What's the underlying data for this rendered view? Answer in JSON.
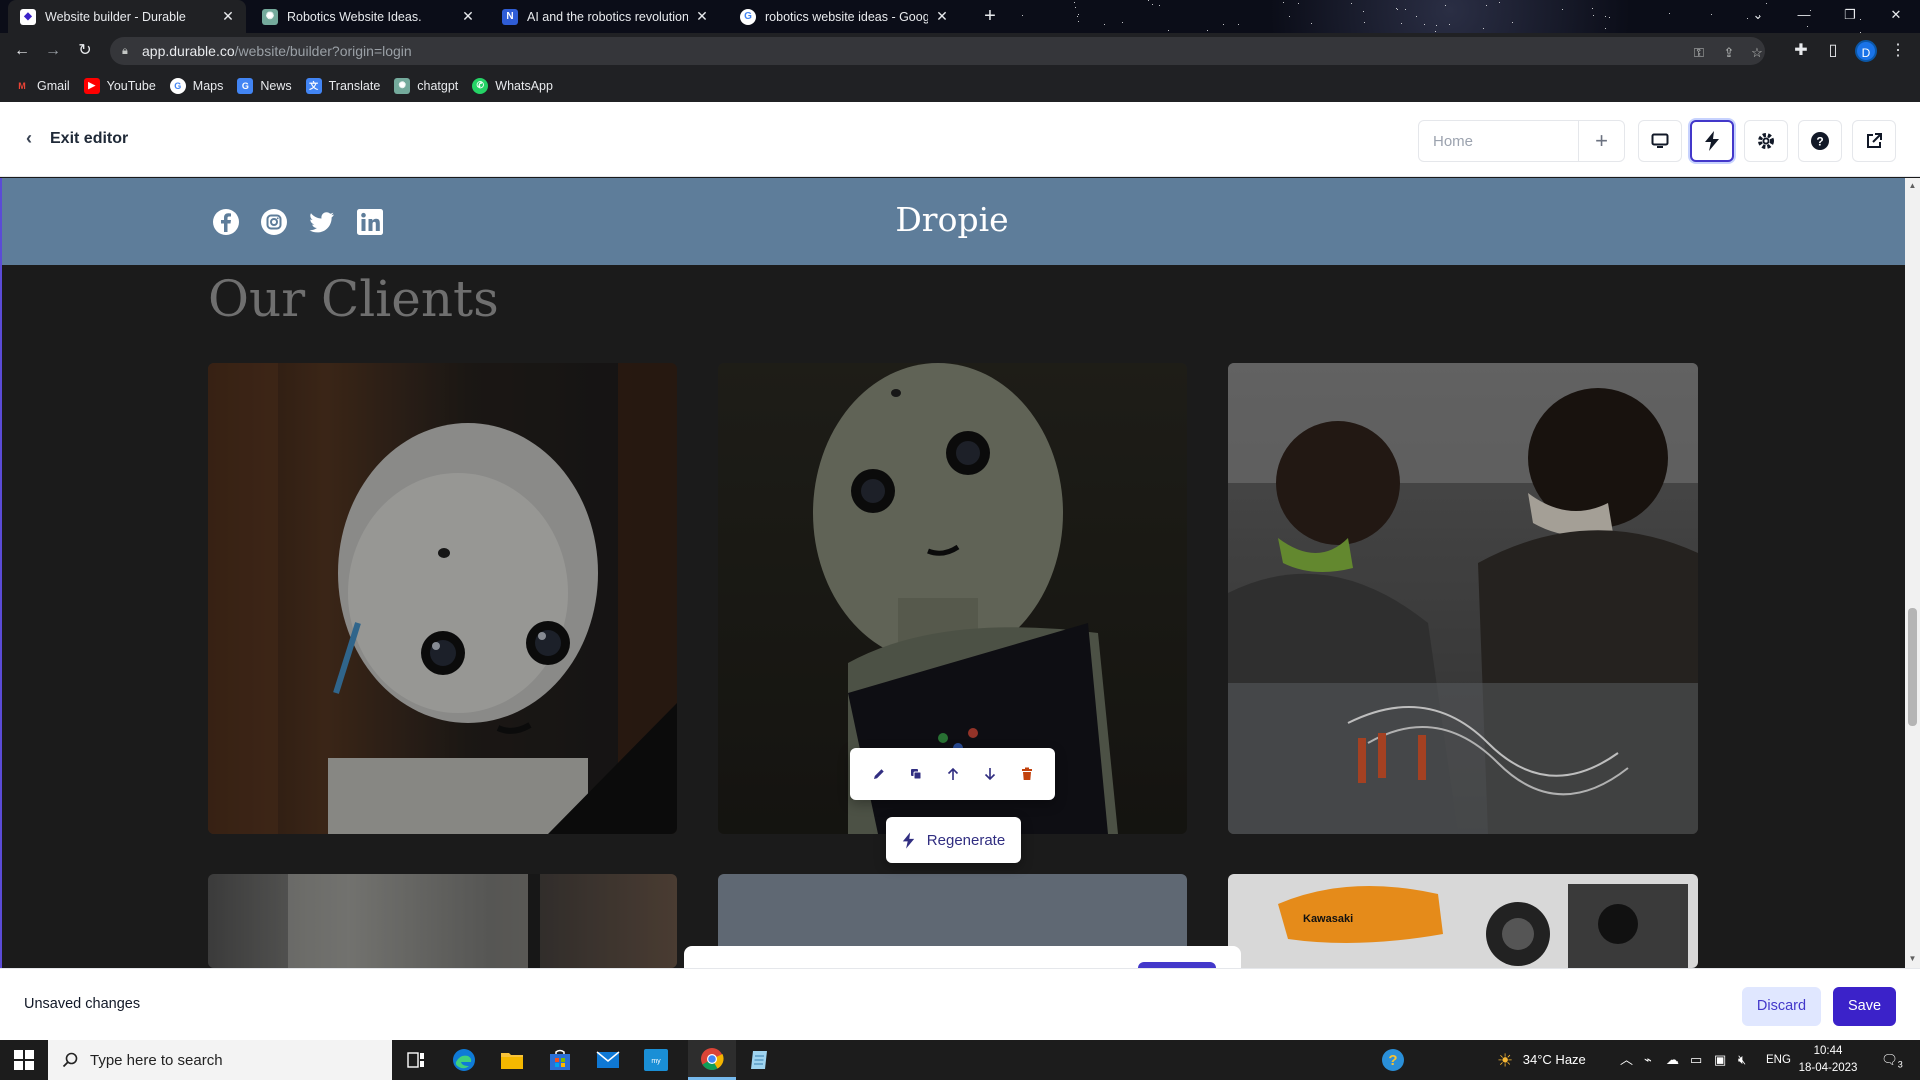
{
  "browser": {
    "tabs": [
      {
        "title": "Website builder - Durable",
        "favicon": "durable-icon",
        "active": true
      },
      {
        "title": "Robotics Website Ideas.",
        "favicon": "chatgpt-icon",
        "active": false
      },
      {
        "title": "AI and the robotics revolution W",
        "favicon": "notion-icon",
        "active": false
      },
      {
        "title": "robotics website ideas - Google",
        "favicon": "google-icon",
        "active": false
      }
    ],
    "url_host": "app.durable.co",
    "url_path": "/website/builder?origin=login",
    "profile_initial": "D",
    "bookmarks": [
      "Gmail",
      "YouTube",
      "Maps",
      "News",
      "Translate",
      "chatgpt",
      "WhatsApp"
    ]
  },
  "editor": {
    "exit_label": "Exit editor",
    "page_select": "Home",
    "header_buttons": [
      "desktop-preview-icon",
      "lightning-icon",
      "gear-icon",
      "help-icon",
      "external-link-icon"
    ]
  },
  "site": {
    "brand": "Dropie",
    "social": [
      "facebook-icon",
      "instagram-icon",
      "twitter-icon",
      "linkedin-icon"
    ],
    "section_heading": "Our Clients",
    "cards": [
      "robot-photo-1",
      "robot-photo-2",
      "engineers-photo",
      "window-photo",
      "sky-photo",
      "kawasaki-robot-photo"
    ],
    "kawasaki_label": "Kawasaki"
  },
  "floating_toolbar": [
    "edit-icon",
    "duplicate-icon",
    "move-up-icon",
    "move-down-icon",
    "delete-icon"
  ],
  "regenerate_label": "Regenerate",
  "action_bar": {
    "status": "Unsaved changes",
    "discard_label": "Discard",
    "save_label": "Save"
  },
  "taskbar": {
    "search_placeholder": "Type here to search",
    "weather": "34°C  Haze",
    "lang": "ENG",
    "time": "10:44",
    "date": "18-04-2023",
    "notifications": "3"
  },
  "colors": {
    "accent": "#3b22c9",
    "site_header": "#5e7d9a",
    "canvas_bg": "#1b1b1b"
  }
}
